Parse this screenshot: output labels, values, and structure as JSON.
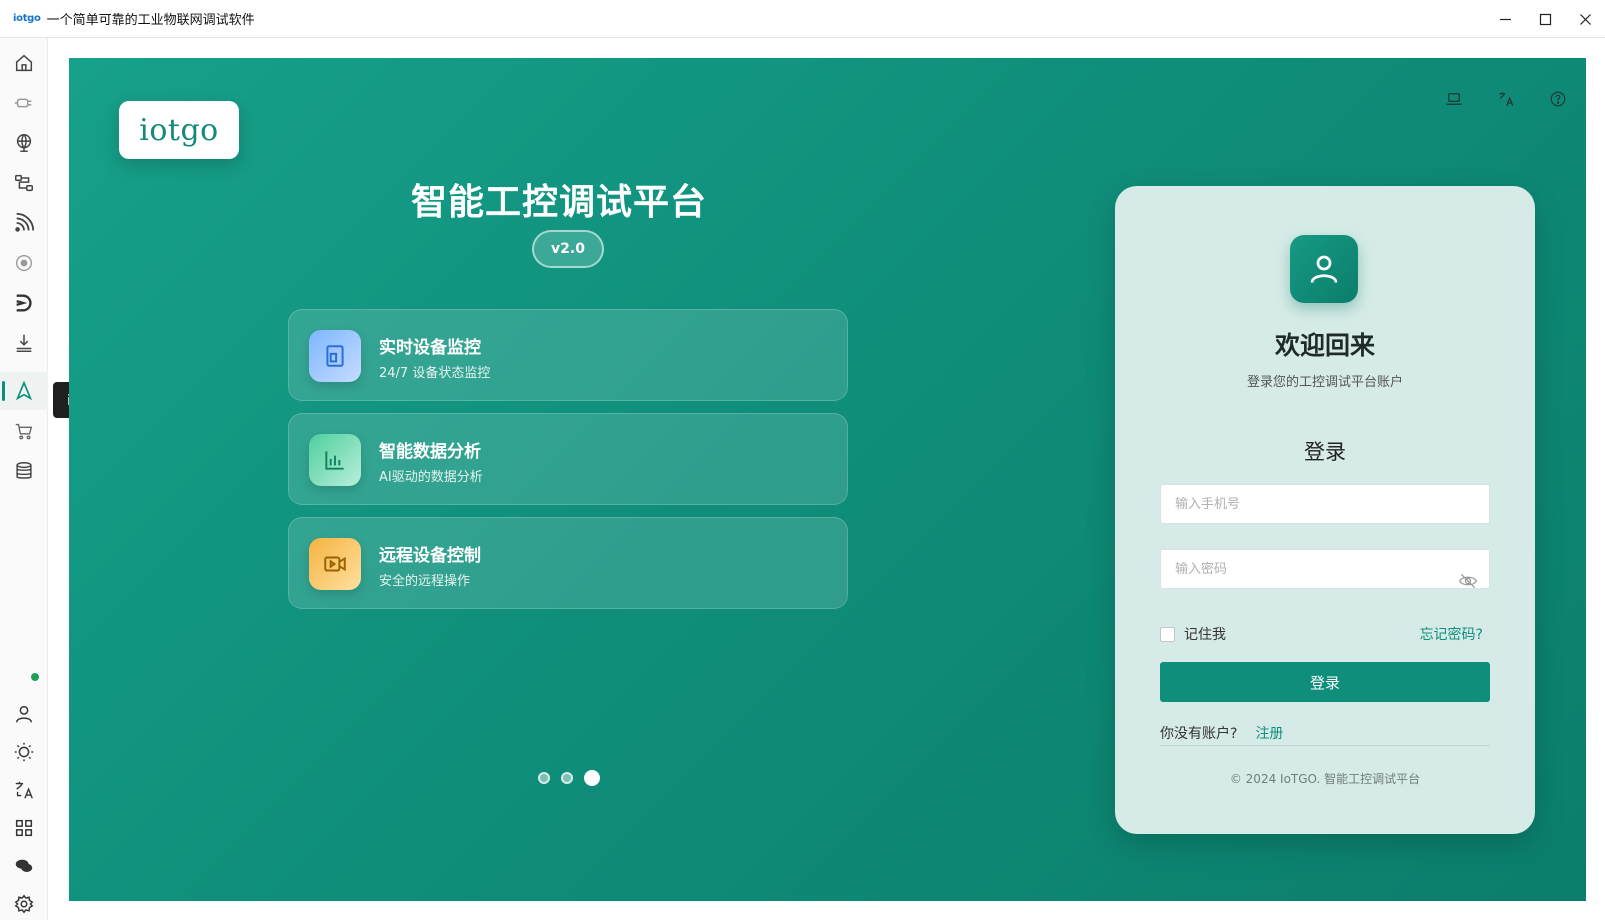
{
  "window": {
    "app_logo": "iotgo",
    "title": "一个简单可靠的工业物联网调试软件"
  },
  "sidebar": {
    "tooltip": "iotgo主页",
    "items": [
      {
        "icon": "home-icon"
      },
      {
        "icon": "plug-icon"
      },
      {
        "icon": "globe-icon"
      },
      {
        "icon": "flow-icon"
      },
      {
        "icon": "rss-icon"
      },
      {
        "icon": "target-icon"
      },
      {
        "icon": "d-logo-icon"
      },
      {
        "icon": "download-icon"
      },
      {
        "icon": "navigate-icon",
        "active": true
      },
      {
        "icon": "cart-icon"
      },
      {
        "icon": "database-icon"
      }
    ],
    "bottom_items": [
      {
        "icon": "user-icon"
      },
      {
        "icon": "sun-icon"
      },
      {
        "icon": "translate-icon"
      },
      {
        "icon": "apps-icon"
      },
      {
        "icon": "chat-icon"
      },
      {
        "icon": "settings-icon"
      }
    ]
  },
  "brand": {
    "logo_text": "iotgo"
  },
  "hero": {
    "title": "智能工控调试平台",
    "version": "v2.0"
  },
  "features": [
    {
      "title": "实时设备监控",
      "subtitle": "24/7 设备状态监控",
      "icon": "device-icon"
    },
    {
      "title": "智能数据分析",
      "subtitle": "AI驱动的数据分析",
      "icon": "chart-icon"
    },
    {
      "title": "远程设备控制",
      "subtitle": "安全的远程操作",
      "icon": "video-icon"
    }
  ],
  "carousel": {
    "count": 3,
    "active_index": 2
  },
  "login": {
    "welcome": "欢迎回来",
    "welcome_sub": "登录您的工控调试平台账户",
    "heading": "登录",
    "phone_placeholder": "输入手机号",
    "password_placeholder": "输入密码",
    "remember_label": "记住我",
    "forgot_label": "忘记密码?",
    "submit_label": "登录",
    "no_account_label": "你没有账户?",
    "signup_label": "注册",
    "copyright": "© 2024 IoTGO. 智能工控调试平台"
  },
  "colors": {
    "accent": "#0f8f7b",
    "panel": "#d6ebe7"
  }
}
